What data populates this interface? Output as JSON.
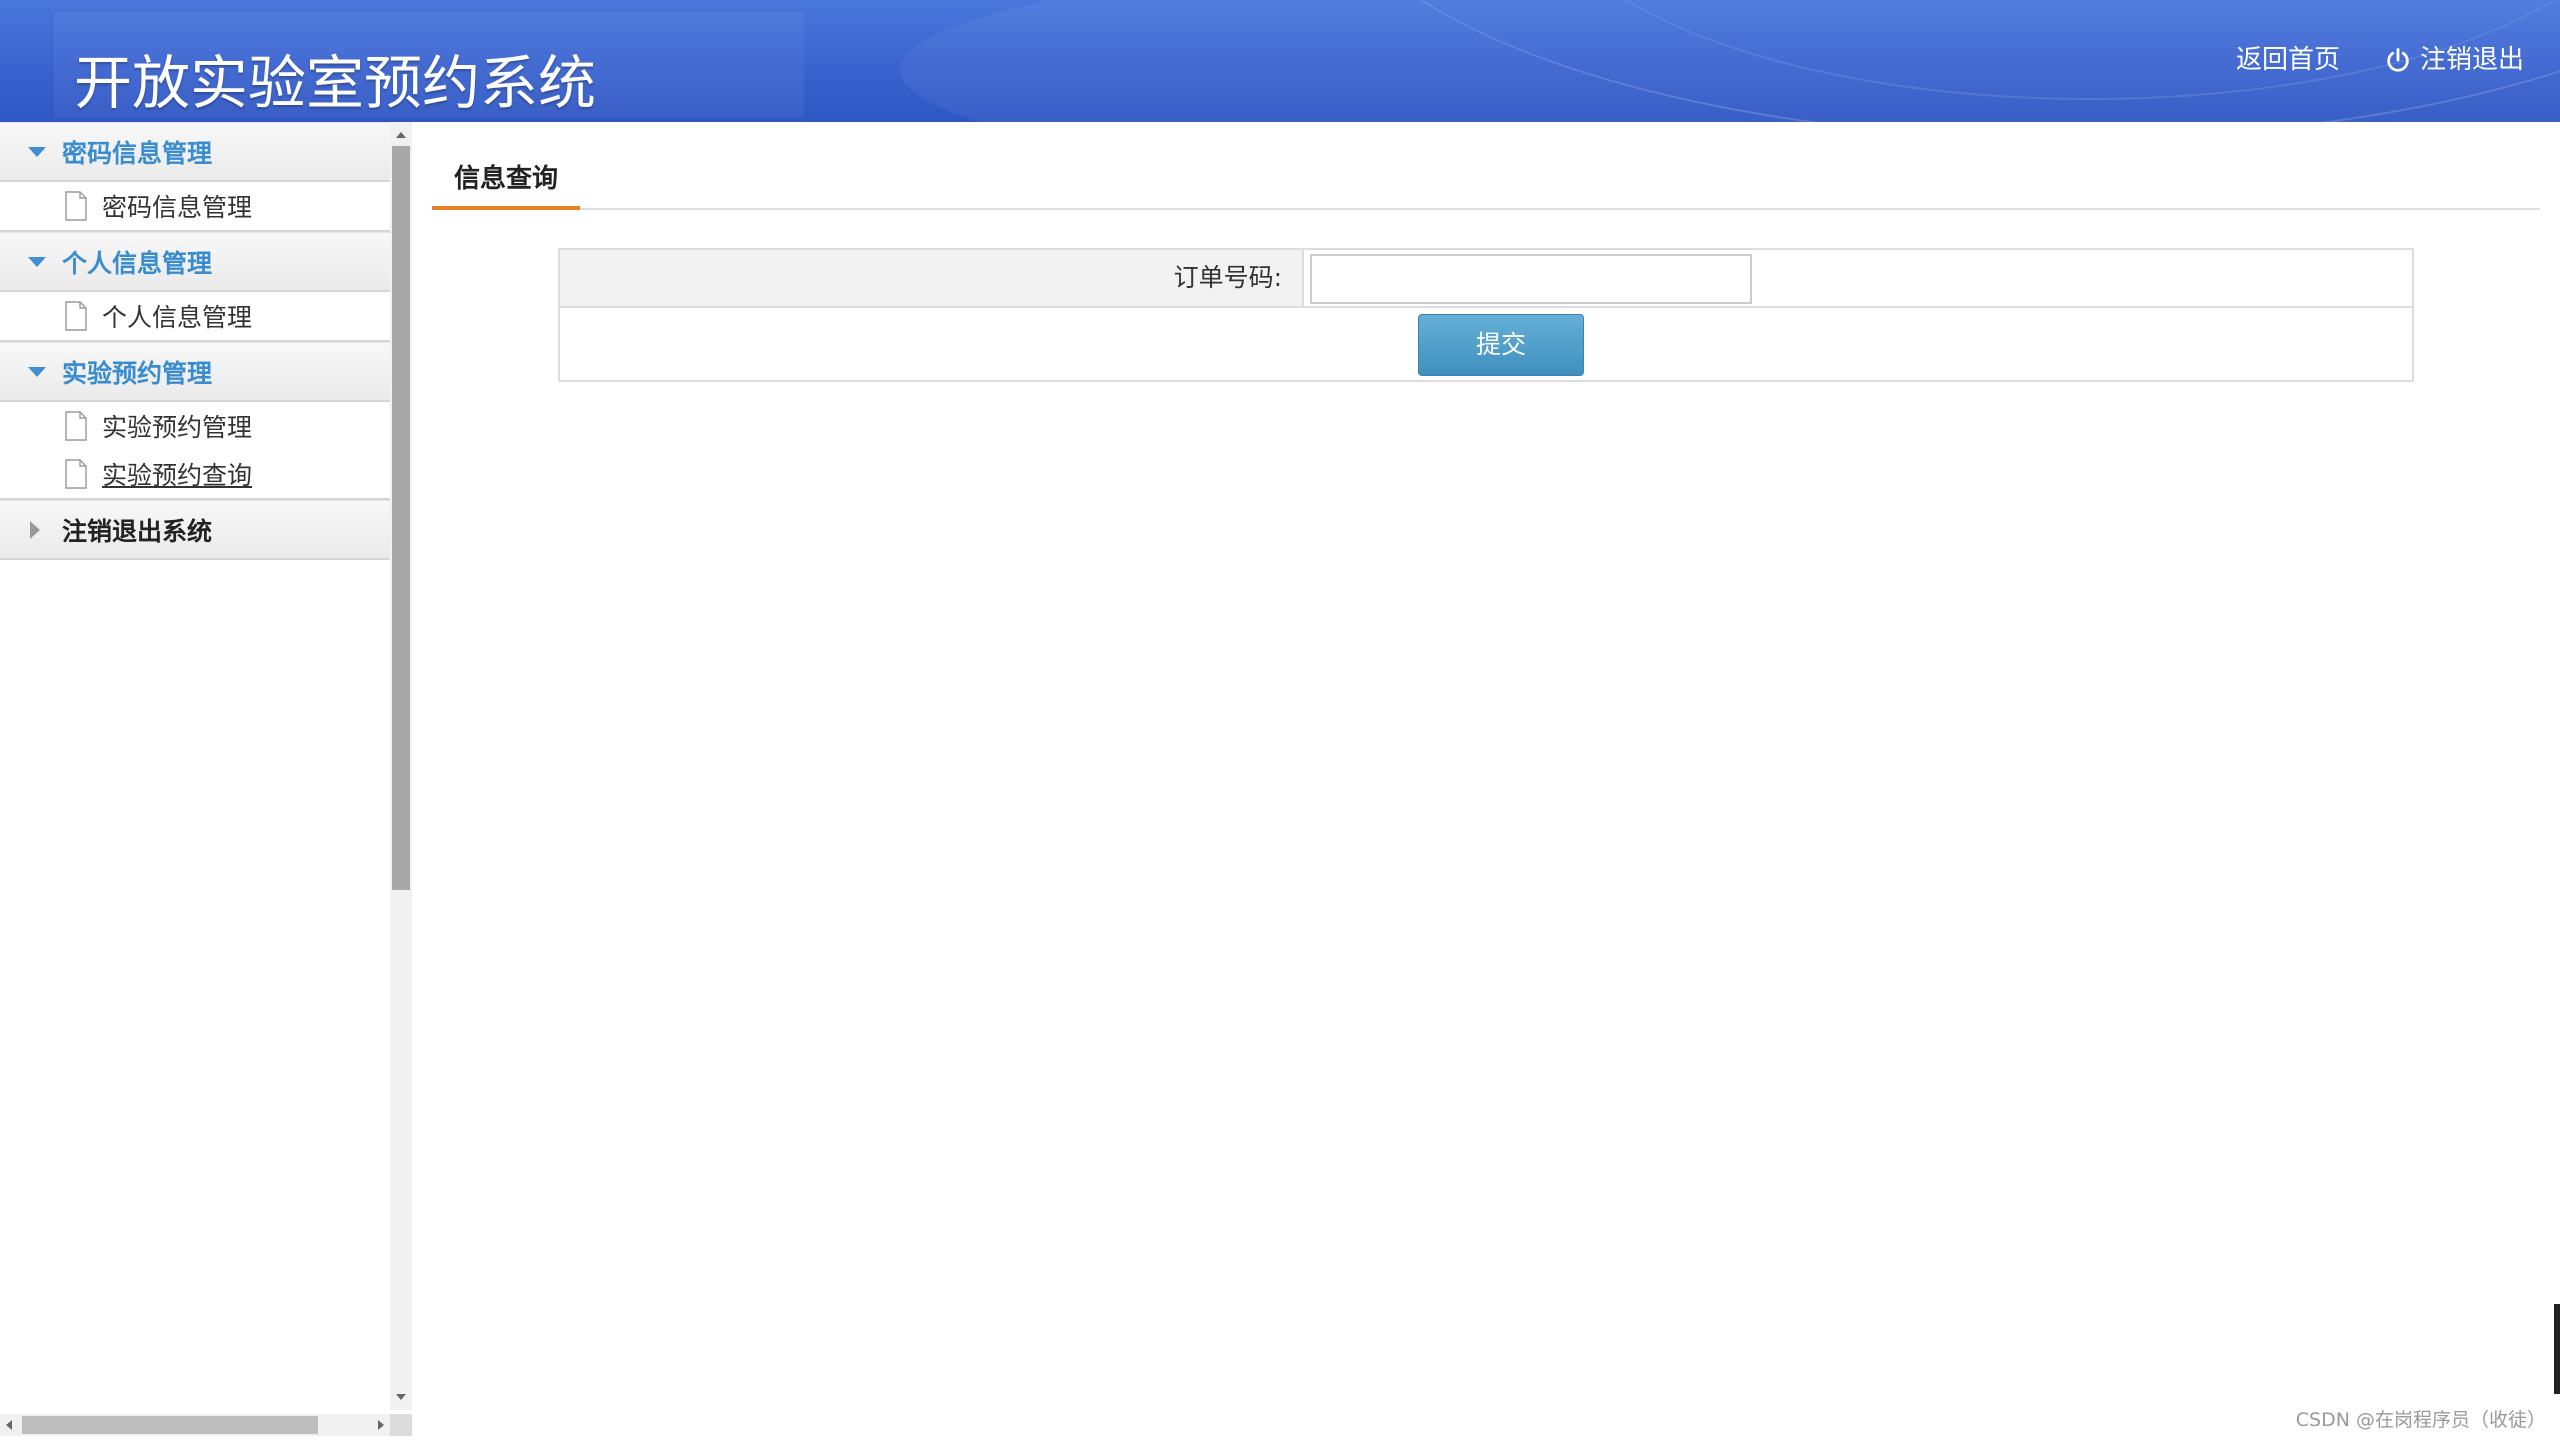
{
  "header": {
    "app_title": "开放实验室预约系统",
    "home_link": "返回首页",
    "logout_link": "注销退出",
    "gradient_colors": [
      "#4a77dc",
      "#2f57c4"
    ]
  },
  "sidebar": {
    "groups": [
      {
        "label": "密码信息管理",
        "expanded": true,
        "items": [
          {
            "label": "密码信息管理"
          }
        ]
      },
      {
        "label": "个人信息管理",
        "expanded": true,
        "items": [
          {
            "label": "个人信息管理"
          }
        ]
      },
      {
        "label": "实验预约管理",
        "expanded": true,
        "items": [
          {
            "label": "实验预约管理"
          },
          {
            "label": "实验预约查询",
            "active": true
          }
        ]
      },
      {
        "label": "注销退出系统",
        "expanded": false,
        "items": []
      }
    ],
    "accent_color": "#3a8cd0"
  },
  "main": {
    "tab_label": "信息查询",
    "tab_accent": "#f07d28",
    "form": {
      "order_label": "订单号码:",
      "order_value": "",
      "submit_label": "提交"
    }
  },
  "watermark": "CSDN @在岗程序员（收徒）"
}
